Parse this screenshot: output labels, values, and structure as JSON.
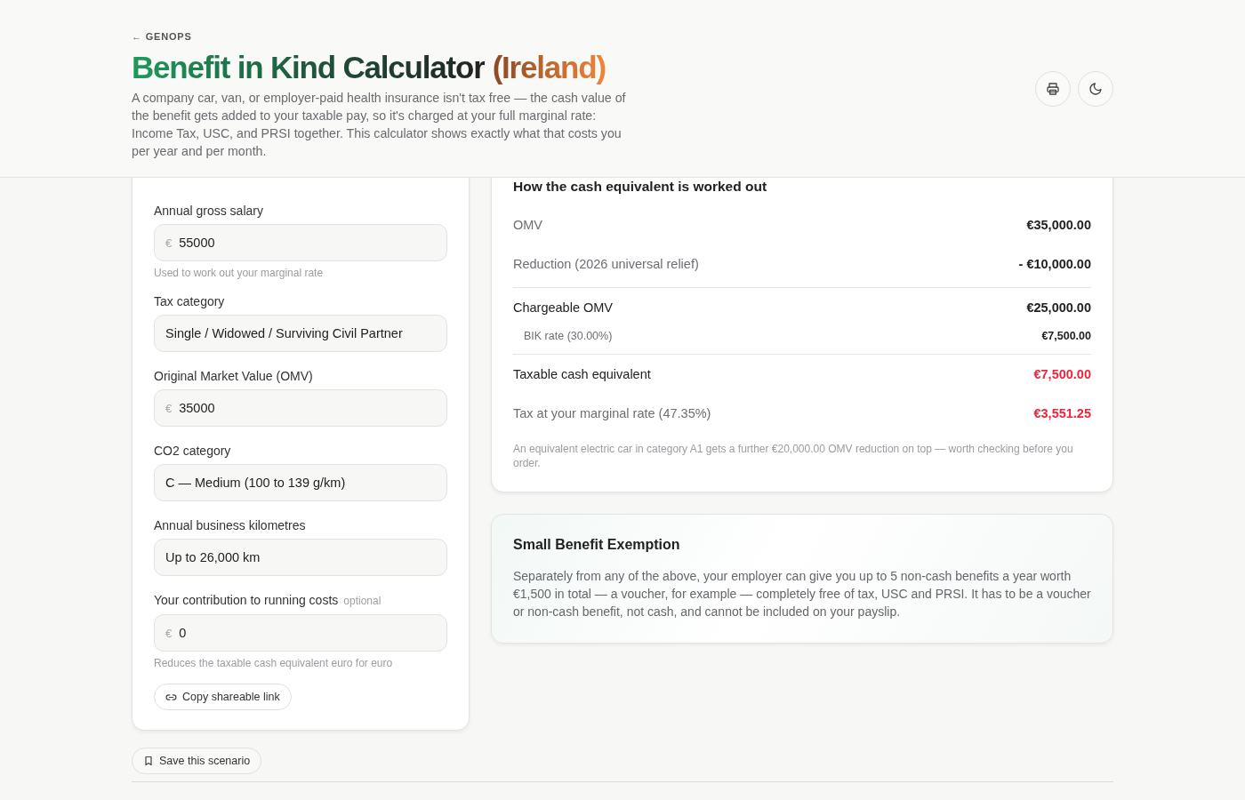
{
  "header": {
    "back_link": "← GENOPS",
    "title": "Benefit in Kind Calculator",
    "title_suffix": "(Ireland)",
    "description": "A company car, van, or employer-paid health insurance isn't tax free — the cash value of the benefit gets added to your taxable pay, so it's charged at your full marginal rate: Income Tax, USC, and PRSI together. This calculator shows exactly what that costs you per year and per month."
  },
  "form": {
    "fields": [
      {
        "label": "Annual gross salary",
        "kind": "currency",
        "prefix": "€",
        "value": "55000",
        "hint": "Used to work out your marginal rate"
      },
      {
        "label": "Tax category",
        "kind": "select",
        "value": "Single / Widowed / Surviving Civil Partner"
      },
      {
        "label": "Original Market Value (OMV)",
        "kind": "currency",
        "prefix": "€",
        "value": "35000"
      },
      {
        "label": "CO2 category",
        "kind": "select",
        "value": "C — Medium (100 to 139 g/km)"
      },
      {
        "label": "Annual business kilometres",
        "kind": "select",
        "value": "Up to 26,000 km"
      },
      {
        "label": "Your contribution to running costs",
        "tag": "optional",
        "kind": "currency",
        "prefix": "€",
        "value": "0",
        "hint": "Reduces the taxable cash equivalent euro for euro"
      }
    ],
    "share_button": "Copy shareable link"
  },
  "save_button": "Save this scenario",
  "breakdown": {
    "title": "How the cash equivalent is worked out",
    "rows": [
      {
        "kind": "base",
        "label": "OMV",
        "value": "€35,000.00",
        "divider": false
      },
      {
        "kind": "base",
        "label": "Reduction (2026 universal relief)",
        "value": "- €10,000.00",
        "divider": false
      },
      {
        "kind": "total",
        "label": "Chargeable OMV",
        "value": "€25,000.00",
        "divider": true
      },
      {
        "kind": "sub",
        "label": "BIK rate (30.00%)",
        "value": "€7,500.00",
        "divider": false
      },
      {
        "kind": "result",
        "label": "Taxable cash equivalent",
        "value": "€7,500.00",
        "divider": true
      },
      {
        "kind": "result-muted",
        "label": "Tax at your marginal rate (47.35%)",
        "value": "€3,551.25",
        "divider": false
      }
    ],
    "note": "An equivalent electric car in category A1 gets a further €20,000.00 OMV reduction on top — worth checking before you order."
  },
  "exemption": {
    "title": "Small Benefit Exemption",
    "text": "Separately from any of the above, your employer can give you up to 5 non-cash benefits a year worth €1,500 in total — a voucher, for example — completely free of tax, USC and PRSI. It has to be a voucher or non-cash benefit, not cash, and cannot be included on your payslip."
  }
}
